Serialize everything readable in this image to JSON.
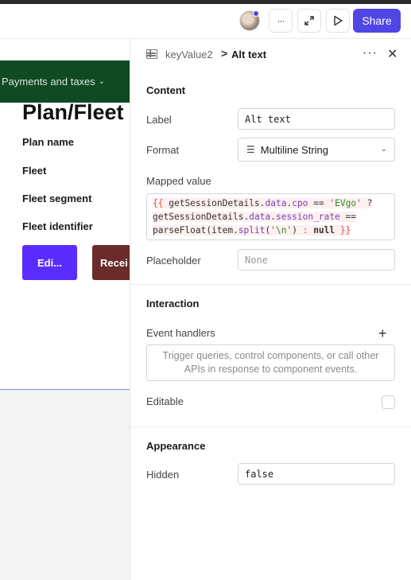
{
  "topbar": {
    "more_label": "···",
    "share_label": "Share"
  },
  "canvas": {
    "nav_label": "Payments and taxes",
    "plan_title": "Plan/Fleet",
    "fields": [
      "Plan name",
      "Fleet",
      "Fleet segment",
      "Fleet identifier"
    ],
    "edit_button": "Edi...",
    "receipt_button": "Recei"
  },
  "inspector": {
    "component_name": "keyValue2",
    "breadcrumb_separator": ">",
    "title": "Alt text",
    "more_label": "···",
    "close_label": "✕",
    "content": {
      "section_title": "Content",
      "label_label": "Label",
      "label_value": "Alt text",
      "format_label": "Format",
      "format_value": "Multiline String",
      "mapped_value_label": "Mapped value",
      "mapped_value_code": "{{ getSessionDetails.data.cpo == 'EVgo' ? getSessionDetails.data.session_rate == parseFloat(item.split('\\n') : null }}",
      "placeholder_label": "Placeholder",
      "placeholder_value": "None"
    },
    "interaction": {
      "section_title": "Interaction",
      "event_handlers_label": "Event handlers",
      "event_handlers_placeholder": "Trigger queries, control components, or call other APIs in response to component events.",
      "editable_label": "Editable",
      "editable_checked": false
    },
    "appearance": {
      "section_title": "Appearance",
      "hidden_label": "Hidden",
      "hidden_value": "false"
    }
  },
  "colors": {
    "accent": "#4f46e5",
    "nav_green": "#0f4a22",
    "edit_button": "#5b2cff",
    "receipt_button": "#6b2b2b"
  },
  "icons": [
    "avatar",
    "more-icon",
    "expand-icon",
    "play-icon",
    "table-icon",
    "close-icon",
    "multiline-icon",
    "chevron-down-icon",
    "plus-icon"
  ]
}
